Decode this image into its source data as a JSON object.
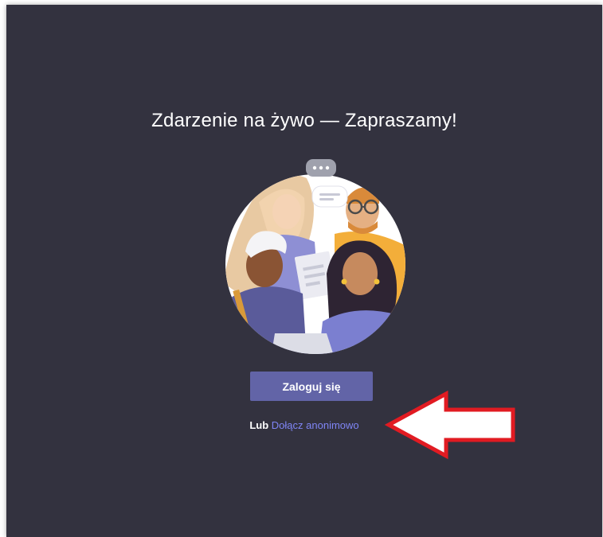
{
  "page": {
    "title": "Zdarzenie na żywo — Zapraszamy!"
  },
  "actions": {
    "signin_label": "Zaloguj się",
    "or_label": "Lub",
    "anonymous_label": "Dołącz anonimowo"
  },
  "colors": {
    "background": "#33323f",
    "accent": "#6264a7",
    "link": "#7f85f5",
    "arrow": "#e11b22"
  },
  "icons": {
    "illustration": "people-illustration",
    "annotation": "arrow-annotation"
  }
}
